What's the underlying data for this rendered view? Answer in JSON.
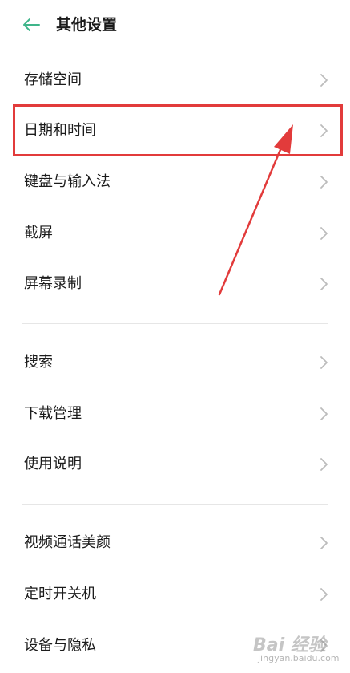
{
  "header": {
    "back_icon": "arrow-left-icon",
    "title": "其他设置",
    "accent_color": "#3fb58a"
  },
  "groups": [
    {
      "items": [
        {
          "label": "存储空间",
          "icon": "chevron-right-icon"
        },
        {
          "label": "日期和时间",
          "icon": "chevron-right-icon",
          "highlighted": true
        },
        {
          "label": "键盘与输入法",
          "icon": "chevron-right-icon"
        },
        {
          "label": "截屏",
          "icon": "chevron-right-icon"
        },
        {
          "label": "屏幕录制",
          "icon": "chevron-right-icon"
        }
      ]
    },
    {
      "items": [
        {
          "label": "搜索",
          "icon": "chevron-right-icon"
        },
        {
          "label": "下载管理",
          "icon": "chevron-right-icon"
        },
        {
          "label": "使用说明",
          "icon": "chevron-right-icon"
        }
      ]
    },
    {
      "items": [
        {
          "label": "视频通话美颜",
          "icon": "chevron-right-icon"
        },
        {
          "label": "定时开关机",
          "icon": "chevron-right-icon"
        },
        {
          "label": "设备与隐私",
          "icon": "chevron-right-icon"
        }
      ]
    }
  ],
  "annotation": {
    "highlight_color": "#e23b3b",
    "pointer": "red-arrow"
  },
  "watermark": {
    "main": "Bai 经验",
    "sub": "jingyan.baidu.com"
  }
}
